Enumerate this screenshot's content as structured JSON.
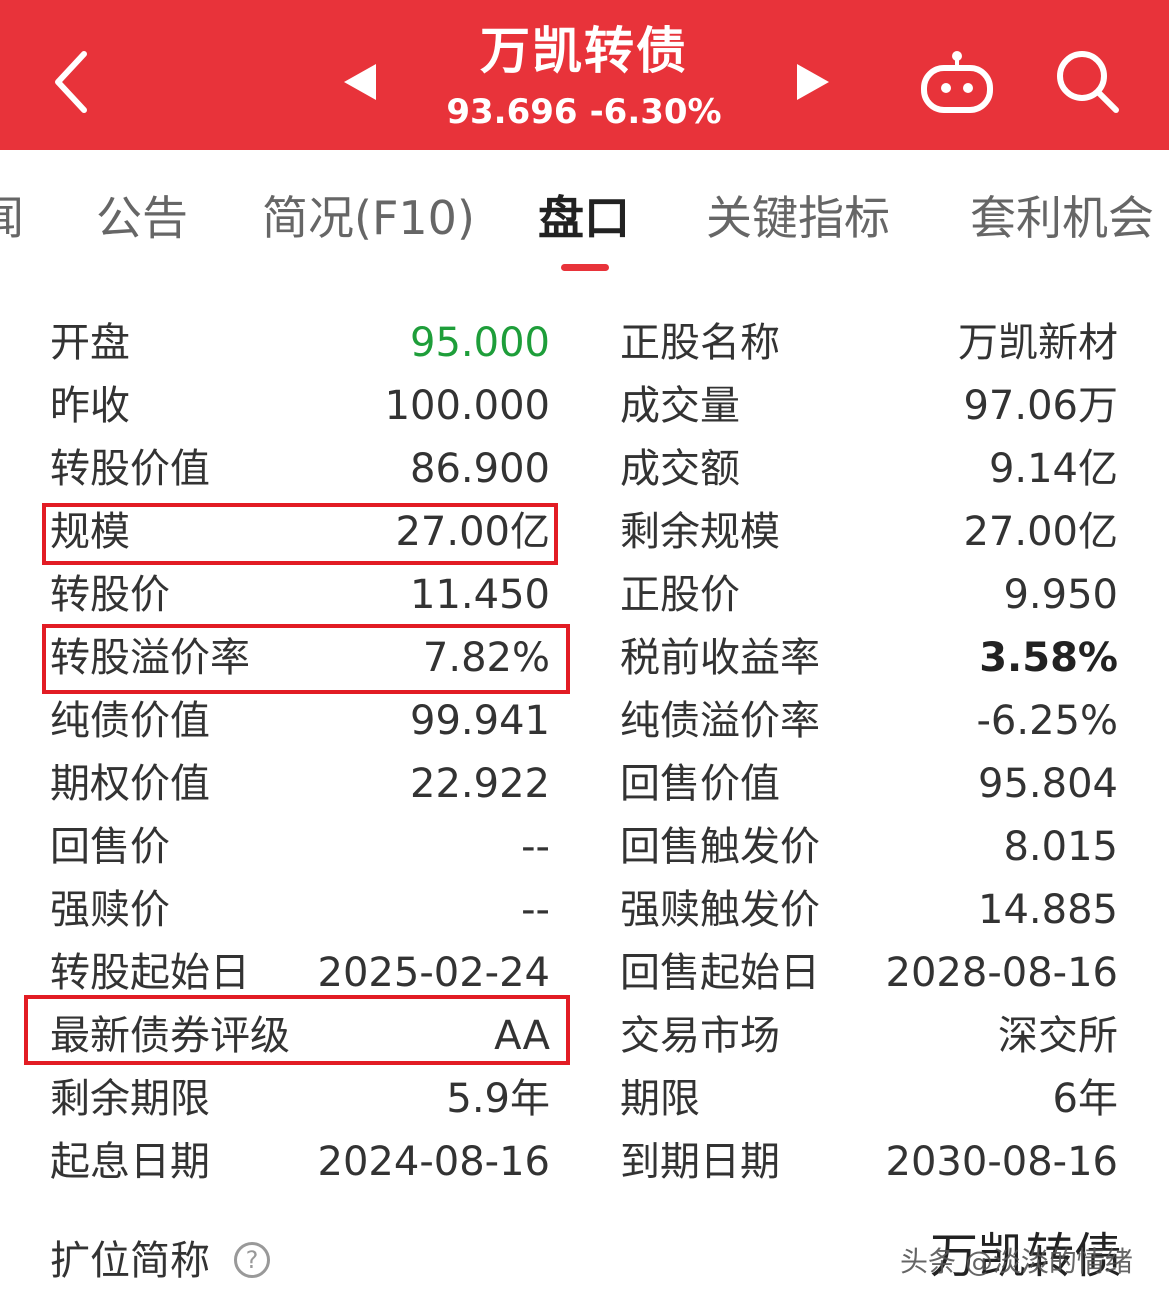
{
  "header": {
    "title": "万凯转债",
    "price": "93.696",
    "change": "-6.30%",
    "background": "#e8333a"
  },
  "tabs": [
    {
      "label": "闻"
    },
    {
      "label": "公告"
    },
    {
      "label": "简况(F10)"
    },
    {
      "label": "盘口",
      "active": true
    },
    {
      "label": "关键指标"
    },
    {
      "label": "套利机会"
    }
  ],
  "left_rows": [
    {
      "label": "开盘",
      "value": "95.000"
    },
    {
      "label": "昨收",
      "value": "100.000"
    },
    {
      "label": "转股价值",
      "value": "86.900"
    },
    {
      "label": "规模",
      "value": "27.00亿"
    },
    {
      "label": "转股价",
      "value": "11.450"
    },
    {
      "label": "转股溢价率",
      "value": "7.82%"
    },
    {
      "label": "纯债价值",
      "value": "99.941"
    },
    {
      "label": "期权价值",
      "value": "22.922"
    },
    {
      "label": "回售价",
      "value": "--"
    },
    {
      "label": "强赎价",
      "value": "--"
    },
    {
      "label": "转股起始日",
      "value": "2025-02-24"
    },
    {
      "label": "最新债券评级",
      "value": "AA"
    },
    {
      "label": "剩余期限",
      "value": "5.9年"
    },
    {
      "label": "起息日期",
      "value": "2024-08-16"
    }
  ],
  "right_rows": [
    {
      "label": "正股名称",
      "value": "万凯新材"
    },
    {
      "label": "成交量",
      "value": "97.06万"
    },
    {
      "label": "成交额",
      "value": "9.14亿"
    },
    {
      "label": "剩余规模",
      "value": "27.00亿"
    },
    {
      "label": "正股价",
      "value": "9.950"
    },
    {
      "label": "税前收益率",
      "value": "3.58%"
    },
    {
      "label": "纯债溢价率",
      "value": "-6.25%"
    },
    {
      "label": "回售价值",
      "value": "95.804"
    },
    {
      "label": "回售触发价",
      "value": "8.015"
    },
    {
      "label": "强赎触发价",
      "value": "14.885"
    },
    {
      "label": "回售起始日",
      "value": "2028-08-16"
    },
    {
      "label": "交易市场",
      "value": "深交所"
    },
    {
      "label": "期限",
      "value": "6年"
    },
    {
      "label": "到期日期",
      "value": "2030-08-16"
    }
  ],
  "colors": {
    "open_price": "#1e9e3a",
    "highlight_box": "#e21c24"
  },
  "footer": {
    "label": "扩位简称",
    "help_glyph": "?",
    "value_partial": "万凯转债",
    "watermark": "头条 @淡淡的情绪"
  }
}
